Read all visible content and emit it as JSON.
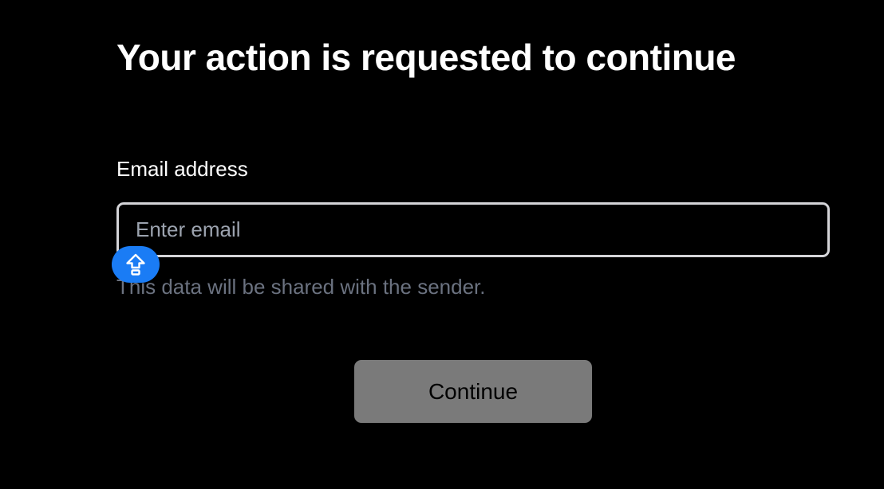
{
  "header": {
    "title": "Your action is requested to continue"
  },
  "form": {
    "email_label": "Email address",
    "email_placeholder": "Enter email",
    "email_value": "",
    "helper_text": "This data will be shared with the sender.",
    "continue_label": "Continue"
  },
  "autofill": {
    "icon": "arrow-up-icon",
    "accent": "#1a7cf5"
  },
  "colors": {
    "background": "#000000",
    "button": "#7a7a7a",
    "helper_text": "#6b7280"
  }
}
